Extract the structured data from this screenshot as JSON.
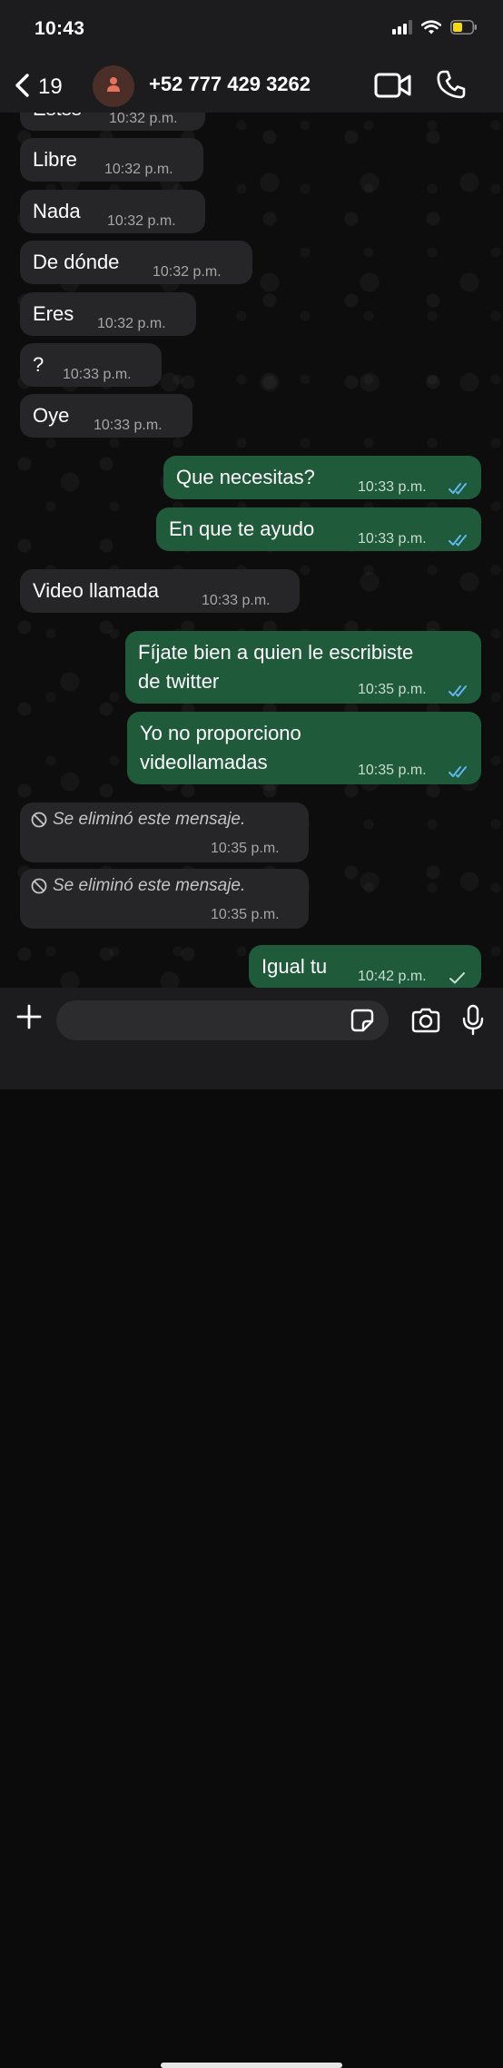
{
  "status_bar": {
    "time": "10:43",
    "icons": [
      "cellular-signal-icon",
      "wifi-icon",
      "battery-icon"
    ],
    "battery_color": "#f5d90a"
  },
  "header": {
    "back_count": "19",
    "contact_name": "+52 777 429 3262",
    "avatar_color": "#4a2e27",
    "avatar_icon_color": "#e8735a"
  },
  "messages": [
    {
      "dir": "in",
      "text": "Estss",
      "time": "10:32 p.m."
    },
    {
      "dir": "in",
      "text": "Libre",
      "time": "10:32 p.m."
    },
    {
      "dir": "in",
      "text": "Nada",
      "time": "10:32 p.m."
    },
    {
      "dir": "in",
      "text": "De dónde",
      "time": "10:32 p.m."
    },
    {
      "dir": "in",
      "text": "Eres",
      "time": "10:32 p.m."
    },
    {
      "dir": "in",
      "text": "?",
      "time": "10:33 p.m."
    },
    {
      "dir": "in",
      "text": "Oye",
      "time": "10:33 p.m."
    },
    {
      "dir": "out",
      "text": "Que necesitas?",
      "time": "10:33 p.m.",
      "status": "read"
    },
    {
      "dir": "out",
      "text": "En que te ayudo",
      "time": "10:33 p.m.",
      "status": "read"
    },
    {
      "dir": "in",
      "text": "Video llamada",
      "time": "10:33 p.m."
    },
    {
      "dir": "out",
      "lines": [
        "Fíjate bien a quien le escribiste",
        "de twitter"
      ],
      "time": "10:35 p.m.",
      "status": "read"
    },
    {
      "dir": "out",
      "lines": [
        "Yo no proporciono",
        "videollamadas"
      ],
      "time": "10:35 p.m.",
      "status": "read"
    },
    {
      "dir": "in",
      "deleted": true,
      "text": "Se eliminó este mensaje.",
      "time": "10:35 p.m."
    },
    {
      "dir": "in",
      "deleted": true,
      "text": "Se eliminó este mensaje.",
      "time": "10:35 p.m."
    },
    {
      "dir": "out",
      "text": "Igual tu",
      "time": "10:42 p.m.",
      "status": "delivered"
    }
  ],
  "colors": {
    "incoming_bubble": "#262628",
    "outgoing_bubble": "#1f5a3b",
    "read_ticks": "#5fb8f0",
    "delivered_ticks": "#c8dccf",
    "bars": "#1c1c1e"
  },
  "composer": {
    "value": "",
    "placeholder": ""
  }
}
